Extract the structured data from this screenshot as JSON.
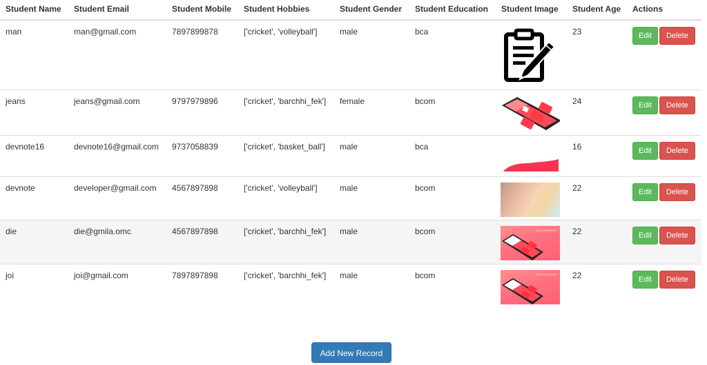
{
  "table": {
    "headers": [
      "Student Name",
      "Student Email",
      "Student Mobile",
      "Student Hobbies",
      "Student Gender",
      "Student Education",
      "Student Image",
      "Student Age",
      "Actions"
    ],
    "rows": [
      {
        "name": "man",
        "email": "man@gmail.com",
        "mobile": "7897899878",
        "hobbies": "['cricket', 'volleyball']",
        "gender": "male",
        "education": "bca",
        "image": "clipboard-pen-icon",
        "age": "23",
        "edit_label": "Edit",
        "delete_label": "Delete"
      },
      {
        "name": "jeans",
        "email": "jeans@gmail.com",
        "mobile": "9797979896",
        "hobbies": "['cricket', 'barchhi_fek']",
        "gender": "female",
        "education": "bcom",
        "image": "phone-app-illustration",
        "age": "24",
        "edit_label": "Edit",
        "delete_label": "Delete"
      },
      {
        "name": "devnote16",
        "email": "devnote16@gmail.com",
        "mobile": "9737058839",
        "hobbies": "['cricket', 'basket_ball']",
        "gender": "male",
        "education": "bca",
        "image": "red-wave-image",
        "age": "16",
        "edit_label": "Edit",
        "delete_label": "Delete"
      },
      {
        "name": "devnote",
        "email": "developer@gmail.com",
        "mobile": "4567897898",
        "hobbies": "['cricket', 'volleyball']",
        "gender": "male",
        "education": "bcom",
        "image": "blurred-gradient-image",
        "age": "22",
        "edit_label": "Edit",
        "delete_label": "Delete"
      },
      {
        "name": "die",
        "email": "die@gmila.omc",
        "mobile": "4567897898",
        "hobbies": "['cricket', 'barchhi_fek']",
        "gender": "male",
        "education": "bcom",
        "image": "icon-creator-banner",
        "image_caption": "ICON CREATOR",
        "age": "22",
        "edit_label": "Edit",
        "delete_label": "Delete",
        "highlighted": true
      },
      {
        "name": "joi",
        "email": "joi@gmail.com",
        "mobile": "7897897898",
        "hobbies": "['cricket', 'barchhi_fek']",
        "gender": "male",
        "education": "bcom",
        "image": "icon-creator-banner",
        "image_caption": "ICON CREATOR",
        "age": "22",
        "edit_label": "Edit",
        "delete_label": "Delete"
      }
    ]
  },
  "footer": {
    "add_button_label": "Add New Record"
  },
  "colors": {
    "edit": "#5cb85c",
    "delete": "#d9534f",
    "primary": "#337ab7",
    "row_hover": "#f5f5f5",
    "border": "#dddddd"
  }
}
